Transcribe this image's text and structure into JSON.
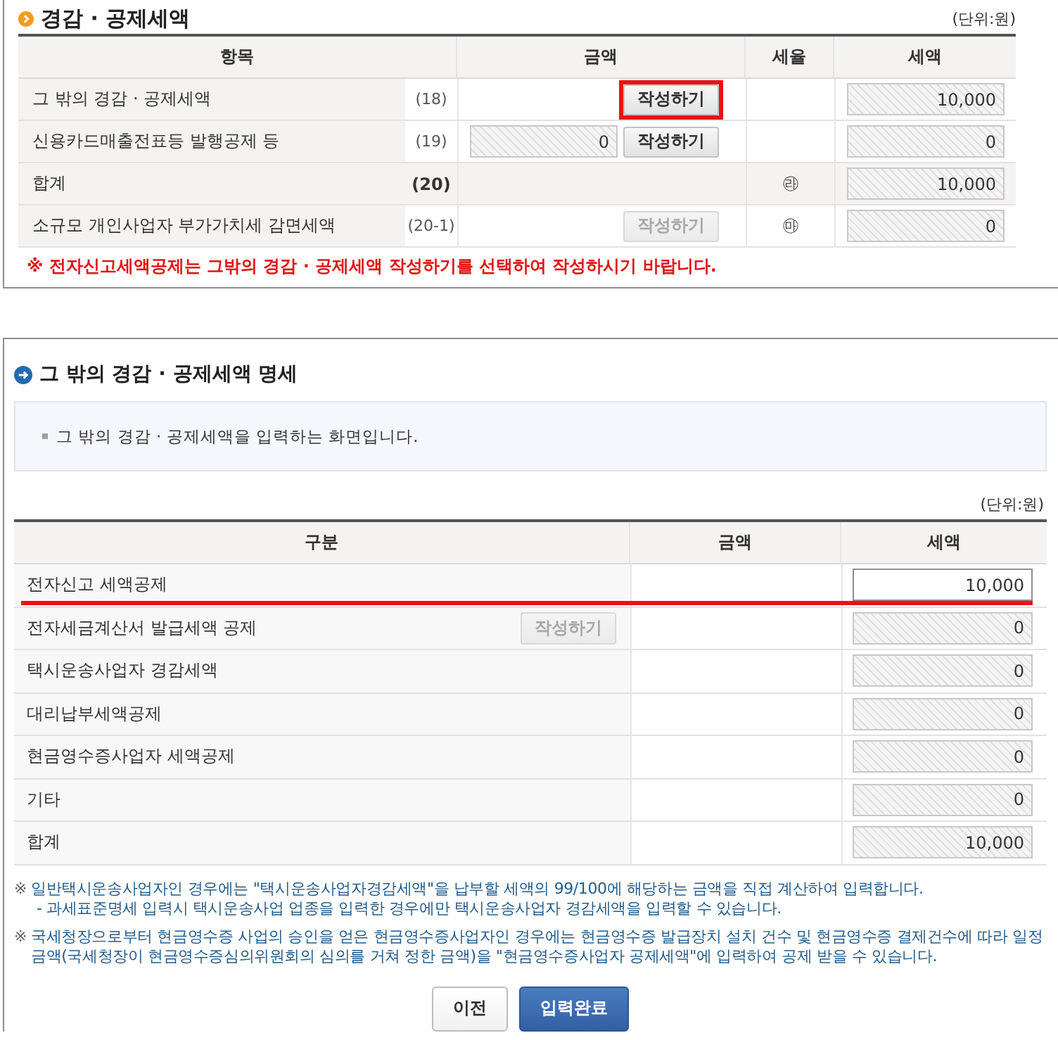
{
  "deduction_section": {
    "title": "경감 · 공제세액",
    "unit": "(단위:원)",
    "table": {
      "columns": [
        "항목",
        "금액",
        "세율",
        "세액"
      ],
      "rows": [
        {
          "kind": "item",
          "label": "그 밖의 경감 · 공제세액",
          "code": "(18)",
          "button": {
            "label": "작성하기",
            "disabled": false,
            "highlighted": true
          },
          "tax": "10,000"
        },
        {
          "kind": "item",
          "label": "신용카드매출전표등 발행공제 등",
          "code": "(19)",
          "amount": "0",
          "button": {
            "label": "작성하기",
            "disabled": false,
            "highlighted": false
          },
          "tax": "0"
        },
        {
          "kind": "total",
          "label": "합계",
          "code": "(20)",
          "rate": "㉱",
          "tax": "10,000"
        },
        {
          "kind": "item",
          "label": "소규모 개인사업자 부가가치세 감면세액",
          "code": "(20-1)",
          "button": {
            "label": "작성하기",
            "disabled": true,
            "highlighted": false
          },
          "rate": "㉲",
          "tax": "0"
        }
      ]
    },
    "notice": "※ 전자신고세액공제는 그밖의 경감 · 공제세액 작성하기를 선택하여 작성하시기 바랍니다."
  },
  "detail_section": {
    "title": "그 밖의 경감 · 공제세액 명세",
    "info": "그 밖의 경감 · 공제세액을 입력하는 화면입니다.",
    "unit": "(단위:원)",
    "table": {
      "columns": [
        "구분",
        "금액",
        "세액"
      ],
      "rows": [
        {
          "label": "전자신고 세액공제",
          "editable": true,
          "highlighted": true,
          "tax": "10,000"
        },
        {
          "label": "전자세금계산서 발급세액 공제",
          "button": {
            "label": "작성하기",
            "disabled": true
          },
          "editable": false,
          "highlighted": false,
          "tax": "0"
        },
        {
          "label": "택시운송사업자 경감세액",
          "editable": false,
          "highlighted": false,
          "tax": "0"
        },
        {
          "label": "대리납부세액공제",
          "editable": false,
          "highlighted": false,
          "tax": "0"
        },
        {
          "label": "현금영수증사업자 세액공제",
          "editable": false,
          "highlighted": false,
          "tax": "0"
        },
        {
          "label": "기타",
          "editable": false,
          "highlighted": false,
          "tax": "0"
        },
        {
          "label": "합계",
          "editable": false,
          "highlighted": false,
          "tax": "10,000"
        }
      ]
    },
    "notes": [
      {
        "mark": "※",
        "text": "일반택시운송사업자인 경우에는 \"택시운송사업자경감세액\"을 납부할 세액의 99/100에 해당하는 금액을 직접 계산하여 입력합니다.",
        "detail": "- 과세표준명세 입력시 택시운송사업 업종을 입력한 경우에만 택시운송사업자 경감세액을 입력할 수 있습니다."
      },
      {
        "mark": "※",
        "text": "국세청장으로부터 현금영수증 사업의 승인을 얻은 현금영수증사업자인 경우에는 현금영수증 발급장치 설치 건수 및 현금영수증 결제건수에 따라 일정금액(국세청장이 현금영수증심의위원회의 심의를 거쳐 정한 금액)을 \"현금영수증사업자 공제세액\"에 입력하여 공제 받을 수 있습니다."
      }
    ],
    "buttons": [
      {
        "label": "이전",
        "kind": "secondary"
      },
      {
        "label": "입력완료",
        "kind": "primary"
      }
    ]
  }
}
